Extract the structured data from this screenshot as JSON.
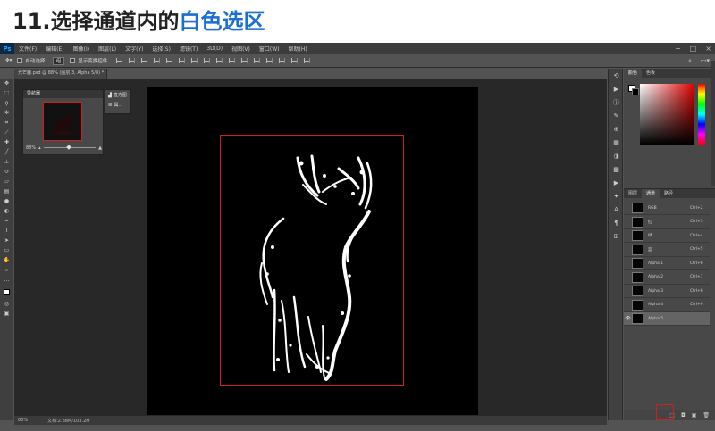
{
  "slide": {
    "title_num": "11.",
    "title_main": "选择通道内的",
    "title_highlight": "白色选区"
  },
  "colors": {
    "accent_blue": "#1b6fd1",
    "selection_red": "#d11f1f",
    "ps_bg": "#535353"
  },
  "app": {
    "logo": "Ps",
    "menu": [
      "文件(F)",
      "编辑(E)",
      "图像(I)",
      "图层(L)",
      "文字(Y)",
      "选择(S)",
      "滤镜(T)",
      "3D(D)",
      "视图(V)",
      "窗口(W)",
      "帮助(H)"
    ],
    "window_controls": [
      "−",
      "□",
      "×"
    ]
  },
  "options_bar": {
    "auto_select_label": "自动选择：",
    "auto_select_value": "组",
    "show_transform_label": "显示变换控件"
  },
  "document": {
    "tab_label": "光芒鹿.psd @ 88% (图层 3, Alpha 5/8) *"
  },
  "statusbar": {
    "zoom": "88%",
    "doc_info": "文档:2.88M/103.2M"
  },
  "navigator": {
    "title": "导航器",
    "zoom": "88%"
  },
  "history_panel": {
    "items": [
      "直方图",
      "属..."
    ]
  },
  "color_panel": {
    "tabs": [
      "颜色",
      "色板"
    ]
  },
  "channels_panel": {
    "tabs": [
      "图层",
      "通道",
      "路径"
    ],
    "rows": [
      {
        "name": "RGB",
        "shortcut": "Ctrl+2",
        "visible": false,
        "selected": false
      },
      {
        "name": "红",
        "shortcut": "Ctrl+3",
        "visible": false,
        "selected": false
      },
      {
        "name": "绿",
        "shortcut": "Ctrl+4",
        "visible": false,
        "selected": false
      },
      {
        "name": "蓝",
        "shortcut": "Ctrl+5",
        "visible": false,
        "selected": false
      },
      {
        "name": "Alpha 1",
        "shortcut": "Ctrl+6",
        "visible": false,
        "selected": false
      },
      {
        "name": "Alpha 2",
        "shortcut": "Ctrl+7",
        "visible": false,
        "selected": false
      },
      {
        "name": "Alpha 3",
        "shortcut": "Ctrl+8",
        "visible": false,
        "selected": false
      },
      {
        "name": "Alpha 4",
        "shortcut": "Ctrl+9",
        "visible": false,
        "selected": false
      },
      {
        "name": "Alpha 5",
        "shortcut": "",
        "visible": true,
        "selected": true
      }
    ]
  },
  "icons": {
    "load_selection": "dotted-circle-icon",
    "save_selection": "mask-icon",
    "new_channel": "new-icon",
    "delete": "trash-icon"
  }
}
